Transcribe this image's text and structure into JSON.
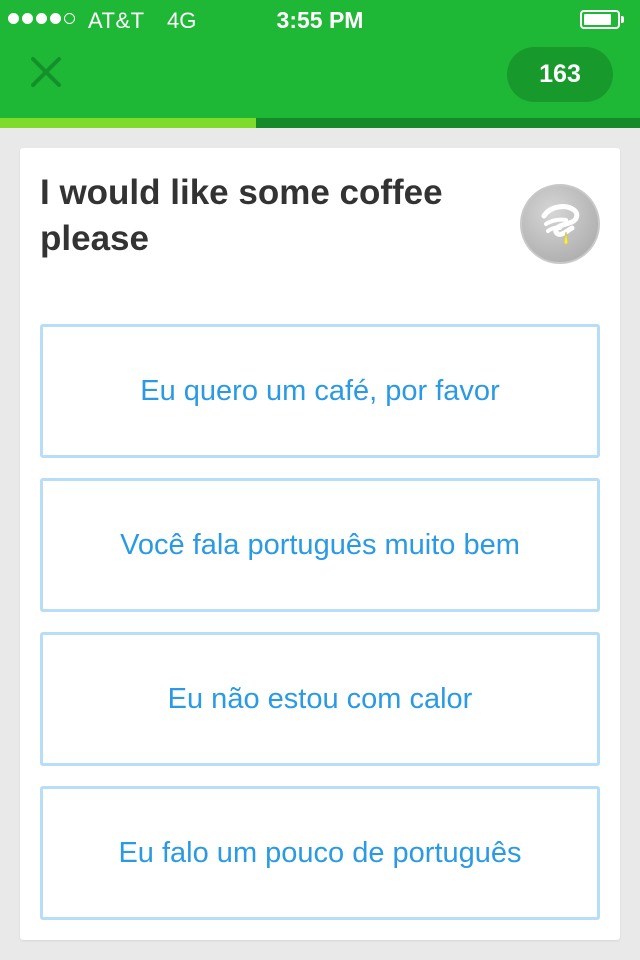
{
  "status_bar": {
    "carrier": "AT&T",
    "network": "4G",
    "time": "3:55 PM",
    "signal_bars_filled": 4,
    "signal_bars_total": 5,
    "battery_level": 0.85
  },
  "header": {
    "close_icon": "close-x-icon",
    "hearts_count": "163",
    "lesson_progress": 0.4,
    "colors": {
      "bar": "#1eb836",
      "pill": "#179a2b",
      "progress_fill": "#7ddb29",
      "progress_track": "#158a28"
    }
  },
  "exercise": {
    "prompt": "I would like some coffee please",
    "speaker_icon": "speaker-hand-icon",
    "options": [
      {
        "label": "Eu quero um café, por favor"
      },
      {
        "label": "Você fala português muito bem"
      },
      {
        "label": "Eu não estou com calor"
      },
      {
        "label": "Eu falo um pouco de português"
      }
    ],
    "colors": {
      "option_text": "#2a9ae5",
      "option_border": "#b7def6"
    }
  }
}
